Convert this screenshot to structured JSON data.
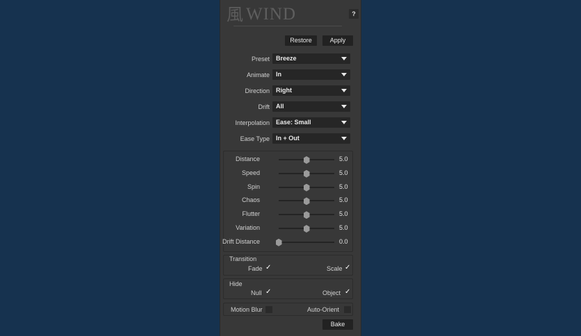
{
  "header": {
    "logo_glyph": "風",
    "title": "WIND",
    "help_label": "?"
  },
  "toolbar": {
    "restore_label": "Restore",
    "apply_label": "Apply"
  },
  "dropdowns": [
    {
      "label": "Preset",
      "value": "Breeze"
    },
    {
      "label": "Animate",
      "value": "In"
    },
    {
      "label": "Direction",
      "value": "Right"
    },
    {
      "label": "Drift",
      "value": "All"
    },
    {
      "label": "Interpolation",
      "value": "Ease: Small"
    },
    {
      "label": "Ease Type",
      "value": "In + Out"
    }
  ],
  "sliders": [
    {
      "label": "Distance",
      "value": "5.0",
      "fraction": 0.5
    },
    {
      "label": "Speed",
      "value": "5.0",
      "fraction": 0.5
    },
    {
      "label": "Spin",
      "value": "5.0",
      "fraction": 0.5
    },
    {
      "label": "Chaos",
      "value": "5.0",
      "fraction": 0.5
    },
    {
      "label": "Flutter",
      "value": "5.0",
      "fraction": 0.5
    },
    {
      "label": "Variation",
      "value": "5.0",
      "fraction": 0.5
    },
    {
      "label": "Drift Distance",
      "value": "0.0",
      "fraction": 0.0
    }
  ],
  "transition": {
    "title": "Transition",
    "fade_label": "Fade",
    "fade_checked": true,
    "scale_label": "Scale",
    "scale_checked": true
  },
  "hide": {
    "title": "Hide",
    "null_label": "Null",
    "null_checked": true,
    "object_label": "Object",
    "object_checked": true
  },
  "options": {
    "motion_blur_label": "Motion Blur",
    "motion_blur_checked": false,
    "auto_orient_label": "Auto-Orient",
    "auto_orient_checked": false
  },
  "footer": {
    "bake_label": "Bake"
  },
  "check_glyph": "✓",
  "colors": {
    "background": "#16324f",
    "panel": "#383838"
  }
}
